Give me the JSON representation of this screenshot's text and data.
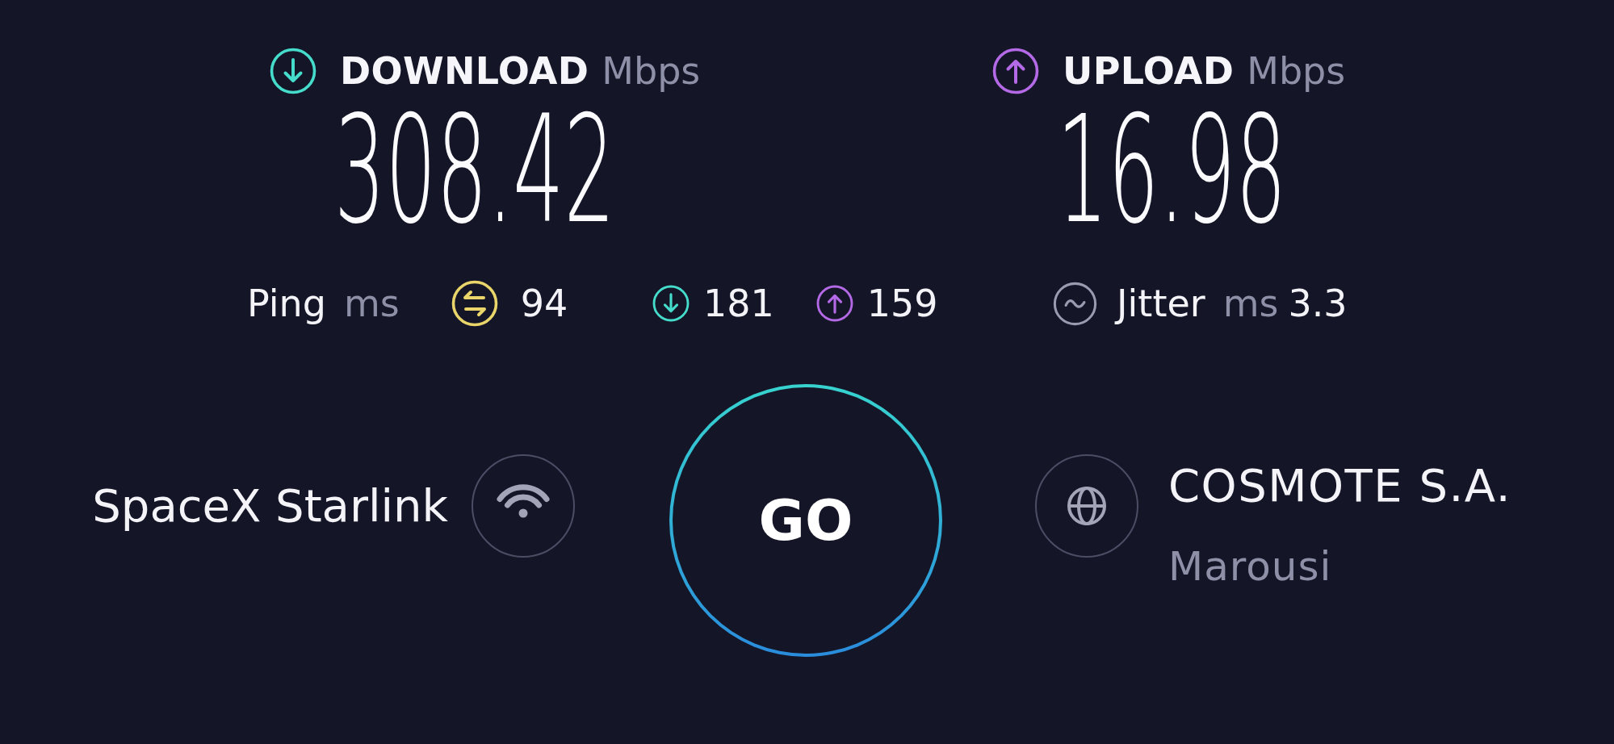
{
  "results": [
    {
      "kind": "download",
      "label": "DOWNLOAD",
      "unit": "Mbps",
      "value": "308.42"
    },
    {
      "kind": "upload",
      "label": "UPLOAD",
      "unit": "Mbps",
      "value": "16.98"
    }
  ],
  "ping": {
    "label": "Ping",
    "unit": "ms",
    "latency": [
      {
        "kind": "idle",
        "value": "94"
      },
      {
        "kind": "download",
        "value": "181"
      },
      {
        "kind": "upload",
        "value": "159"
      }
    ]
  },
  "jitter": {
    "label": "Jitter",
    "unit": "ms",
    "value": "3.3"
  },
  "provider": {
    "name": "SpaceX Starlink"
  },
  "go_button": {
    "label": "GO"
  },
  "server": {
    "name": "COSMOTE S.A.",
    "location": "Marousi"
  }
}
